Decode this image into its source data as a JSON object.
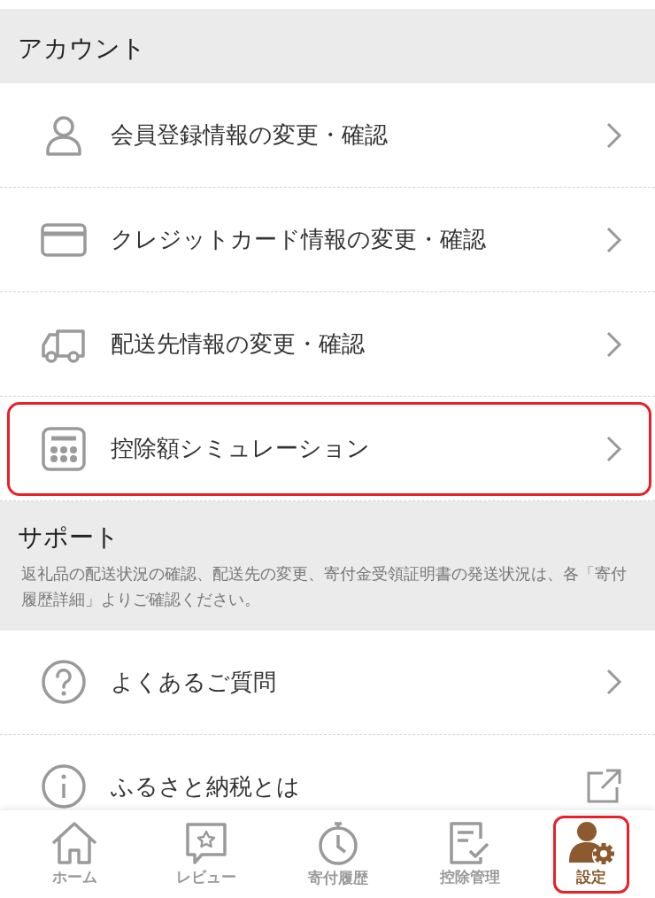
{
  "sections": [
    {
      "title": "アカウント",
      "items": [
        {
          "label": "会員登録情報の変更・確認",
          "kind": "chevron",
          "highlighted": false
        },
        {
          "label": "クレジットカード情報の変更・確認",
          "kind": "chevron",
          "highlighted": false
        },
        {
          "label": "配送先情報の変更・確認",
          "kind": "chevron",
          "highlighted": false
        },
        {
          "label": "控除額シミュレーション",
          "kind": "chevron",
          "highlighted": true
        }
      ]
    },
    {
      "title": "サポート",
      "description": "返礼品の配送状況の確認、配送先の変更、寄付金受領証明書の発送状況は、各「寄付履歴詳細」よりご確認ください。",
      "items": [
        {
          "label": "よくあるご質問",
          "kind": "chevron",
          "highlighted": false
        },
        {
          "label": "ふるさと納税とは",
          "kind": "external",
          "highlighted": false
        }
      ]
    }
  ],
  "tab_bar": [
    {
      "label": "ホーム",
      "selected": false,
      "highlighted": false
    },
    {
      "label": "レビュー",
      "selected": false,
      "highlighted": false
    },
    {
      "label": "寄付履歴",
      "selected": false,
      "highlighted": false
    },
    {
      "label": "控除管理",
      "selected": false,
      "highlighted": false
    },
    {
      "label": "設定",
      "selected": true,
      "highlighted": true
    }
  ]
}
